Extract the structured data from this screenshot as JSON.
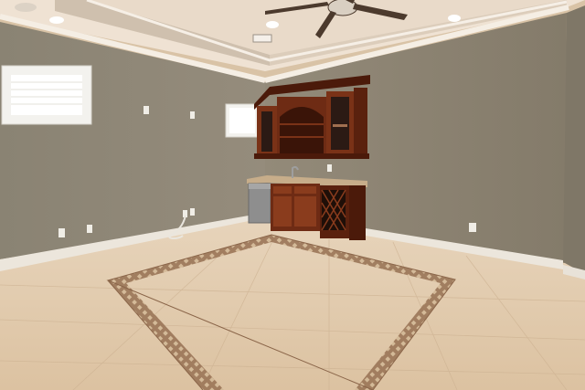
{
  "scene": {
    "description_free": true,
    "palette": {
      "ceiling": "#efe2d3",
      "ceiling_recess": "#e7d7c6",
      "crown_molding": "#f4ede3",
      "wall_left": "#8d8576",
      "wall_back": "#8b8372",
      "wall_right": "#857d6d",
      "baseboard": "#ece6dc",
      "floor": "#dcc4a5",
      "floor_light": "#e8d6bd",
      "border_tile": "#9a7557",
      "border_accent": "#e9dcc8",
      "cabinet": "#6e2b14",
      "cabinet_light": "#8a3c1d",
      "cabinet_dark": "#4b1a0a",
      "countertop": "#c7ad8a",
      "appliance": "#8e8e8e",
      "glass": "#2b1a14",
      "window_frame": "#f3f2ee",
      "window_glass": "#ffffff",
      "fan": "#4c3a2d"
    }
  }
}
